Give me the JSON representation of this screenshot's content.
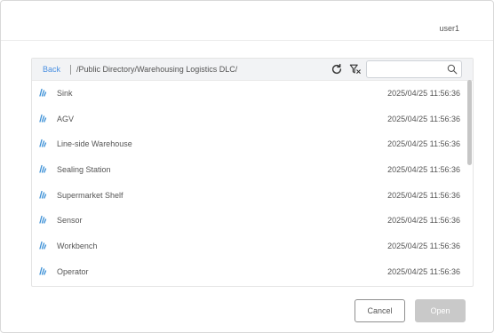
{
  "header": {
    "username": "user1"
  },
  "toolbar": {
    "back_label": "Back",
    "path": "/Public Directory/Warehousing Logistics DLC/",
    "search_placeholder": "",
    "search_value": ""
  },
  "files": [
    {
      "name": "Sink",
      "date": "2025/04/25 11:56:36"
    },
    {
      "name": "AGV",
      "date": "2025/04/25 11:56:36"
    },
    {
      "name": "Line-side Warehouse",
      "date": "2025/04/25 11:56:36"
    },
    {
      "name": "Sealing Station",
      "date": "2025/04/25 11:56:36"
    },
    {
      "name": "Supermarket Shelf",
      "date": "2025/04/25 11:56:36"
    },
    {
      "name": "Sensor",
      "date": "2025/04/25 11:56:36"
    },
    {
      "name": "Workbench",
      "date": "2025/04/25 11:56:36"
    },
    {
      "name": "Operator",
      "date": "2025/04/25 11:56:36"
    }
  ],
  "footer": {
    "cancel_label": "Cancel",
    "open_label": "Open"
  },
  "colors": {
    "accent": "#4a90e2",
    "file_icon": "#3a8fd6",
    "disabled_button": "#c9c9c9"
  }
}
